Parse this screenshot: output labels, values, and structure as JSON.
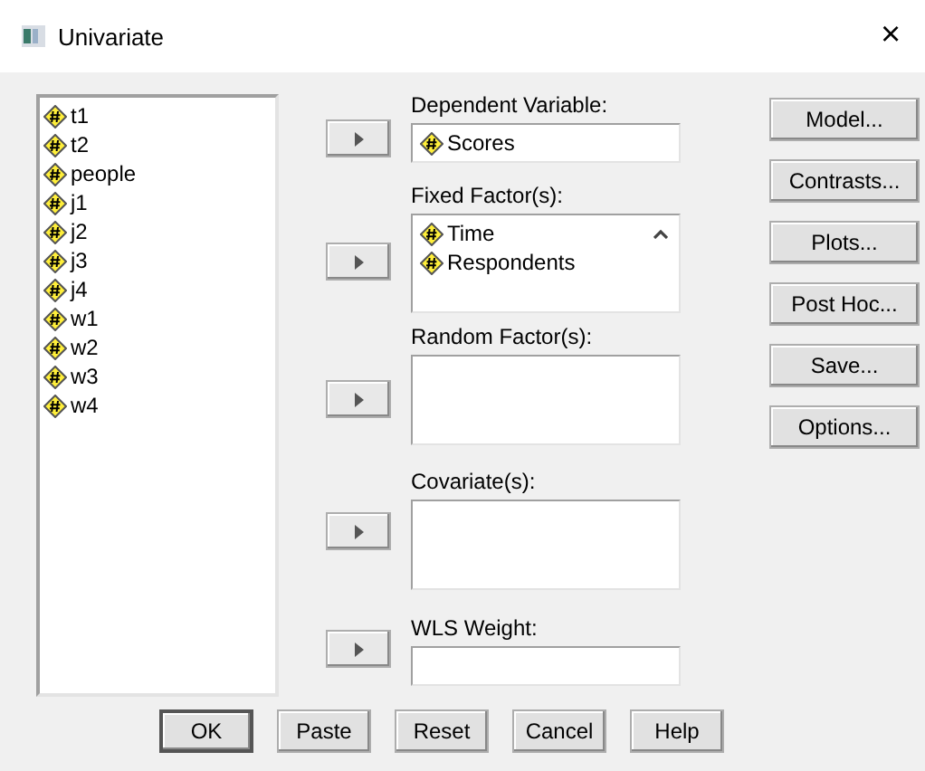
{
  "window": {
    "title": "Univariate",
    "close": "×"
  },
  "variables": [
    {
      "name": "t1"
    },
    {
      "name": "t2"
    },
    {
      "name": "people"
    },
    {
      "name": "j1"
    },
    {
      "name": "j2"
    },
    {
      "name": "j3"
    },
    {
      "name": "j4"
    },
    {
      "name": "w1"
    },
    {
      "name": "w2"
    },
    {
      "name": "w3"
    },
    {
      "name": "w4"
    }
  ],
  "targets": [
    {
      "kind": "field",
      "label": "Dependent Variable:",
      "items": [
        "Scores"
      ]
    },
    {
      "kind": "list",
      "label": "Fixed Factor(s):",
      "items": [
        "Time",
        "Respondents"
      ]
    },
    {
      "kind": "list",
      "label": "Random Factor(s):"
    },
    {
      "kind": "list",
      "label": "Covariate(s):"
    },
    {
      "kind": "field",
      "label": "WLS Weight:"
    }
  ],
  "side_buttons": [
    "Model...",
    "Contrasts...",
    "Plots...",
    "Post Hoc...",
    "Save...",
    "Options..."
  ],
  "bottom_buttons": [
    {
      "label": "OK",
      "default": true
    },
    {
      "label": "Paste",
      "default": false
    },
    {
      "label": "Reset",
      "default": false
    },
    {
      "label": "Cancel",
      "default": false
    },
    {
      "label": "Help",
      "default": false
    }
  ]
}
